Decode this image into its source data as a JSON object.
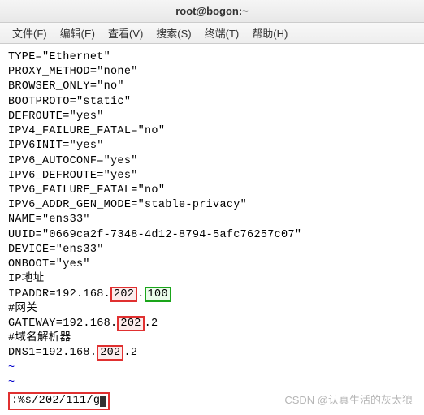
{
  "title": "root@bogon:~",
  "menu": {
    "file": "文件(F)",
    "edit": "编辑(E)",
    "view": "查看(V)",
    "search": "搜索(S)",
    "terminal": "终端(T)",
    "help": "帮助(H)"
  },
  "config": {
    "type": "TYPE=\"Ethernet\"",
    "proxy": "PROXY_METHOD=\"none\"",
    "browser": "BROWSER_ONLY=\"no\"",
    "bootproto": "BOOTPROTO=\"static\"",
    "defroute": "DEFROUTE=\"yes\"",
    "ipv4ff": "IPV4_FAILURE_FATAL=\"no\"",
    "ipv6init": "IPV6INIT=\"yes\"",
    "ipv6auto": "IPV6_AUTOCONF=\"yes\"",
    "ipv6def": "IPV6_DEFROUTE=\"yes\"",
    "ipv6ff": "IPV6_FAILURE_FATAL=\"no\"",
    "ipv6addr": "IPV6_ADDR_GEN_MODE=\"stable-privacy\"",
    "name": "NAME=\"ens33\"",
    "uuid": "UUID=\"0669ca2f-7348-4d12-8794-5afc76257c07\"",
    "device": "DEVICE=\"ens33\"",
    "onboot": "ONBOOT=\"yes\"",
    "ipaddr_label": "IP地址",
    "ipaddr_prefix": "IPADDR=192.168.",
    "ipaddr_hl1": "202",
    "ipaddr_dot": ".",
    "ipaddr_hl2": "100",
    "gateway_label": "#网关",
    "gateway_prefix": "GATEWAY=192.168.",
    "gateway_hl": "202",
    "gateway_suffix": ".2",
    "dns_label": "#域名解析器",
    "dns_prefix": "DNS1=192.168.",
    "dns_hl": "202",
    "dns_suffix": ".2"
  },
  "tilde": "~",
  "command": ":%s/202/111/g",
  "watermark": "CSDN @认真生活的灰太狼"
}
